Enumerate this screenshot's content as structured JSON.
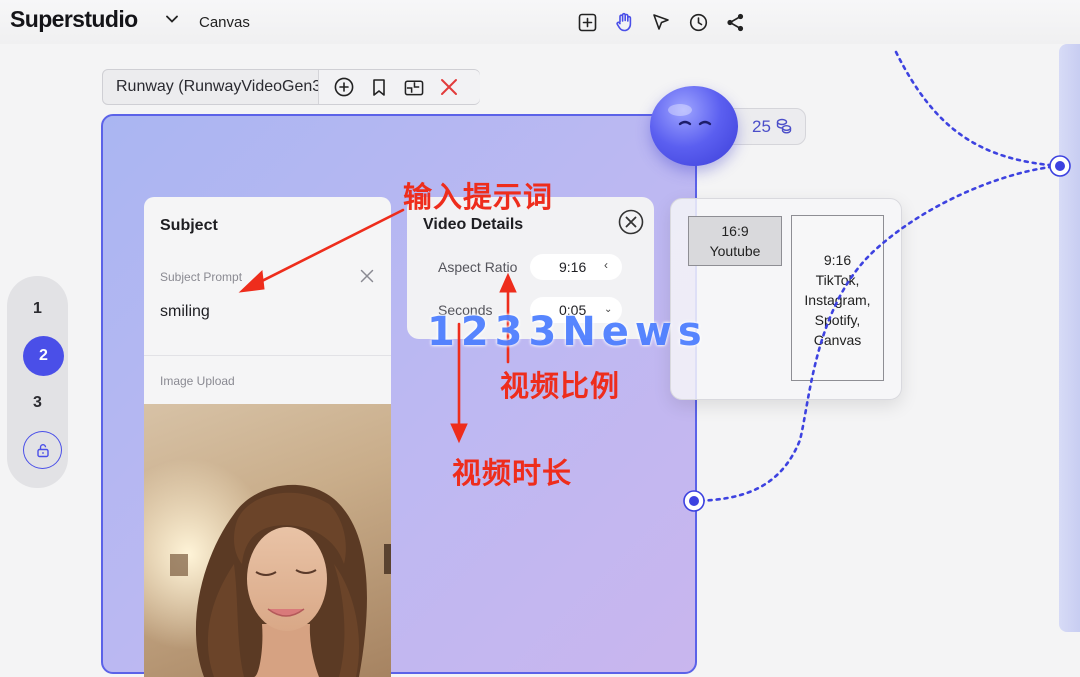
{
  "header": {
    "brand": "Superstudio",
    "breadcrumb": "Canvas",
    "tools": [
      "add-frame-icon",
      "hand-icon",
      "pointer-icon",
      "history-icon",
      "share-icon"
    ]
  },
  "node": {
    "title": "Runway (RunwayVideoGen3)",
    "actions": [
      "add-icon",
      "bookmark-icon",
      "minimize-icon",
      "close-icon"
    ],
    "accent": "#4a4fe8",
    "credits": "25"
  },
  "subject": {
    "title": "Subject",
    "prompt_label": "Subject Prompt",
    "prompt_value": "smiling",
    "image_label": "Image Upload"
  },
  "video_details": {
    "title": "Video Details",
    "aspect_label": "Aspect Ratio",
    "aspect_value": "9:16",
    "seconds_label": "Seconds",
    "seconds_value": "0:05"
  },
  "ratio_options": {
    "youtube": {
      "ratio": "16:9",
      "name": "Youtube"
    },
    "vertical": {
      "ratio": "9:16",
      "names": [
        "TikTok,",
        "Instagram,",
        "Spotify,",
        "Canvas"
      ]
    }
  },
  "steps": [
    "1",
    "2",
    "3"
  ],
  "annotations": {
    "prompt": "输入提示词",
    "ratio": "视频比例",
    "duration": "视频时长",
    "watermark": "1233News",
    "color": "#ee2d1c"
  }
}
